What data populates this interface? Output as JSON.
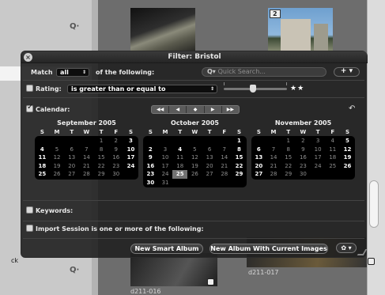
{
  "background": {
    "left_label_fragment": "ck",
    "file_labels": [
      "d211-016",
      "d211-017"
    ],
    "photo_badge": "2"
  },
  "panel": {
    "title": "Filter: Bristol",
    "match_prefix": "Match",
    "match_value": "all",
    "match_suffix": "of the following:",
    "search_placeholder": "Quick Search...",
    "add_button": "+ ▾",
    "rating": {
      "label": "Rating:",
      "operator": "is greater than or equal to",
      "stars": "★★",
      "stars_value": 2,
      "checked": false
    },
    "calendar": {
      "label": "Calendar:",
      "checked": true,
      "nav": [
        "◀◀",
        "◀",
        "◆",
        "▶",
        "▶▶"
      ],
      "dows": [
        "S",
        "M",
        "T",
        "W",
        "T",
        "F",
        "S"
      ],
      "months": [
        {
          "title": "September 2005",
          "rows": [
            [
              "",
              "",
              "",
              "",
              "1",
              "2",
              "3"
            ],
            [
              "4",
              "5",
              "6",
              "7",
              "8",
              "9",
              "10"
            ],
            [
              "11",
              "12",
              "13",
              "14",
              "15",
              "16",
              "17"
            ],
            [
              "18",
              "19",
              "20",
              "21",
              "22",
              "23",
              "24"
            ],
            [
              "25",
              "26",
              "27",
              "28",
              "29",
              "30",
              ""
            ]
          ]
        },
        {
          "title": "October 2005",
          "rows": [
            [
              "",
              "",
              "",
              "",
              "",
              "",
              "1"
            ],
            [
              "2",
              "3",
              "4",
              "5",
              "6",
              "7",
              "8"
            ],
            [
              "9",
              "10",
              "11",
              "12",
              "13",
              "14",
              "15"
            ],
            [
              "16",
              "17",
              "18",
              "19",
              "20",
              "21",
              "22"
            ],
            [
              "23",
              "24",
              "25",
              "26",
              "27",
              "28",
              "29"
            ],
            [
              "30",
              "31",
              "",
              "",
              "",
              "",
              ""
            ]
          ],
          "selected": "25",
          "highlighted": [
            "4",
            "22"
          ]
        },
        {
          "title": "November 2005",
          "rows": [
            [
              "",
              "",
              "1",
              "2",
              "3",
              "4",
              "5"
            ],
            [
              "6",
              "7",
              "8",
              "9",
              "10",
              "11",
              "12"
            ],
            [
              "13",
              "14",
              "15",
              "16",
              "17",
              "18",
              "19"
            ],
            [
              "20",
              "21",
              "22",
              "23",
              "24",
              "25",
              "26"
            ],
            [
              "27",
              "28",
              "29",
              "30",
              "",
              "",
              ""
            ]
          ]
        }
      ]
    },
    "keywords_label": "Keywords:",
    "import_label": "Import Session is one or more of the following:",
    "new_smart_album": "New Smart Album",
    "new_album_current": "New Album With Current Images",
    "gear_button": "✿ ▾"
  }
}
